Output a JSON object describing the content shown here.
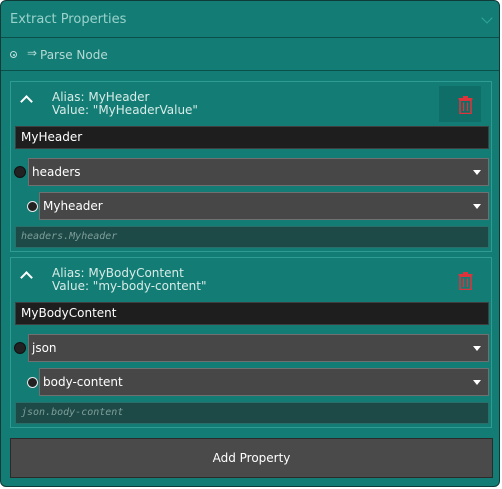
{
  "header": {
    "title": "Extract Properties"
  },
  "parse": {
    "label": "Parse Node",
    "arrow": "⇒"
  },
  "properties": [
    {
      "alias": "Alias: MyHeader",
      "value": "Value: \"MyHeaderValue\"",
      "name": "MyHeader",
      "source": "headers",
      "key": "Myheader",
      "path": "headers.Myheader"
    },
    {
      "alias": "Alias: MyBodyContent",
      "value": "Value: \"my-body-content\"",
      "name": "MyBodyContent",
      "source": "json",
      "key": "body-content",
      "path": "json.body-content"
    }
  ],
  "actions": {
    "add_label": "Add Property"
  },
  "colors": {
    "accent": "#137d75",
    "delete": "#e0323b"
  }
}
